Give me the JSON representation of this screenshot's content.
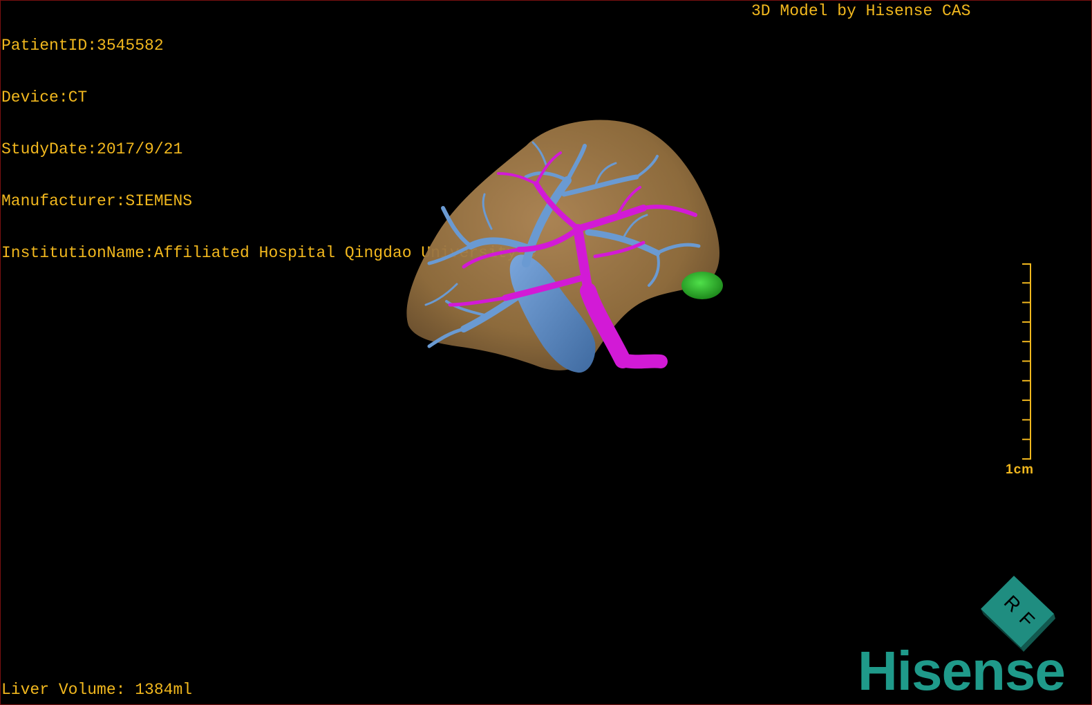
{
  "info": {
    "patient_id": "PatientID:3545582",
    "device": "Device:CT",
    "study_date": "StudyDate:2017/9/21",
    "manufacturer": "Manufacturer:SIEMENS",
    "institution": "InstitutionName:Affiliated Hospital Qingdao University-C"
  },
  "title": "3D Model by Hisense CAS",
  "liver_volume": "Liver Volume: 1384ml",
  "scale": {
    "label": "1cm",
    "ticks": 10
  },
  "orientation_cube": {
    "labels": [
      "R",
      "F"
    ],
    "color": "#1f8d80"
  },
  "logo": {
    "text": "Hisense",
    "color": "#1f9a8a"
  },
  "colors": {
    "overlay_text": "#f2b81e",
    "liver": "#9b7548",
    "hepatic_vein": "#5f8fc8",
    "portal_vein": "#d21ad6",
    "lesion": "#2fb52a",
    "border": "#7a1010"
  }
}
